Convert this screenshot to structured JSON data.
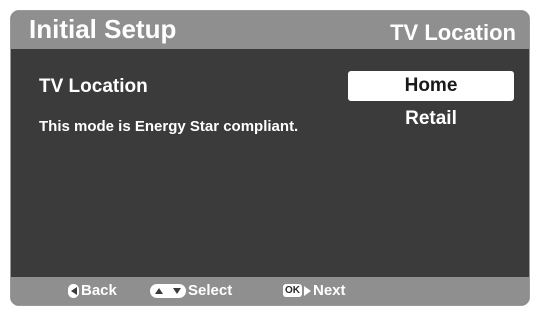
{
  "header": {
    "title": "Initial Setup",
    "section": "TV Location"
  },
  "setting": {
    "label": "TV Location",
    "description": "This mode is Energy Star compliant."
  },
  "options": [
    {
      "label": "Home",
      "selected": true
    },
    {
      "label": "Retail",
      "selected": false
    }
  ],
  "footer": {
    "back": {
      "icon": "left-arrow-button-icon",
      "label": "Back"
    },
    "select": {
      "icon": "up-down-arrow-buttons-icon",
      "label": "Select"
    },
    "next": {
      "icon": "ok-button-icon",
      "ok_text": "OK",
      "label": "Next"
    }
  },
  "colors": {
    "header_bg": "#8f8f8f",
    "panel_bg": "#3b3b3b",
    "selected_bg": "#ffffff",
    "text": "#ffffff"
  }
}
